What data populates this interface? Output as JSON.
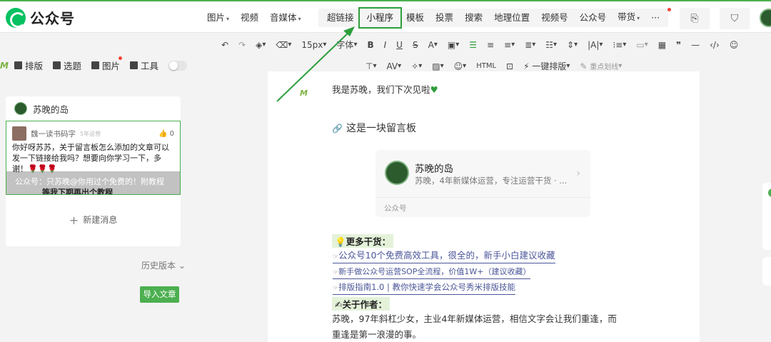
{
  "header": {
    "logo_text": "公众号",
    "menu_a": [
      {
        "label": "图片",
        "caret": true
      },
      {
        "label": "视频",
        "caret": false
      },
      {
        "label": "音媒体",
        "caret": true
      }
    ],
    "menu_b": [
      {
        "label": "超链接",
        "caret": false
      },
      {
        "label": "小程序",
        "caret": false,
        "active": true
      },
      {
        "label": "模板",
        "caret": false
      },
      {
        "label": "投票",
        "caret": false
      },
      {
        "label": "搜索",
        "caret": false
      },
      {
        "label": "地理位置",
        "caret": false
      },
      {
        "label": "视频号",
        "caret": false
      },
      {
        "label": "公众号",
        "caret": false
      },
      {
        "label": "带货",
        "caret": true
      },
      {
        "label": "···",
        "caret": false
      }
    ],
    "caret_glyph": "▾"
  },
  "toolbar": {
    "font_size": "15px",
    "font_label": "字体",
    "one_key_layout": "一键排版",
    "highlight_line": "重点划线"
  },
  "left_tools": {
    "layout": "排版",
    "topic": "选题",
    "image": "图片",
    "tools": "工具"
  },
  "left_panel": {
    "account_name": "苏晚的岛",
    "msg_author": "魏一读书码字",
    "msg_sub": "5年运营",
    "msg_likes": "0",
    "msg_text": "你好呀苏苏，关于留言板怎么添加的文章可以发一下链接给我吗？想要向你学习一下，多谢！🌹🌹🌹",
    "overlay_text": "公众号：只苏晚@你用过个免费的！附教程",
    "reply_text": "等我下期再出个教程",
    "new_message": "新建消息",
    "history": "历史版本",
    "import_button": "导入文章"
  },
  "article": {
    "p1": "我是苏晚，我们下次见啦",
    "link_title": "这是一块留言板",
    "card_name": "苏晚的岛",
    "card_desc": "苏晚，4年新媒体运营，专注运营干货 · ...",
    "card_type": "公众号",
    "section1": "更多干货：",
    "links": [
      "公众号10个免费高效工具，很全的，新手小白建议收藏",
      "新手做公众号运营SOP全流程，价值1W+（建议收藏）",
      "排版指南1.0 | 教你快速学会公众号秀米排版技能"
    ],
    "section2": "关于作者：",
    "author_text": "苏晚，97年斜杠少女，主业4年新媒体运营，相信文字会让我们重逢，而重逢是第一浪漫的事。"
  },
  "colors": {
    "brand_green": "#07c160",
    "accent_green": "#4caf50",
    "highlight_border": "#2e9e3a",
    "link_blue": "#4b5699"
  }
}
